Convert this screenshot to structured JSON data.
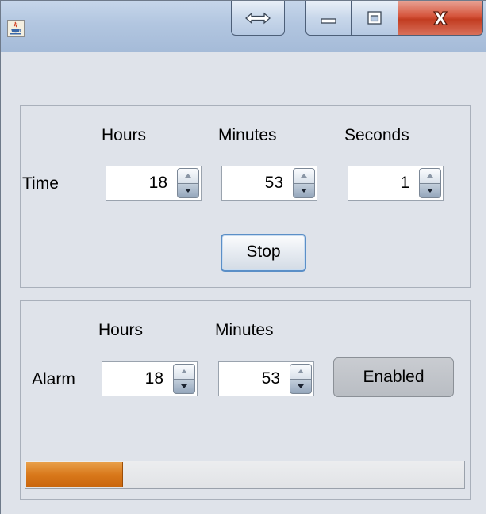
{
  "time_panel": {
    "row_label": "Time",
    "hours_label": "Hours",
    "minutes_label": "Minutes",
    "seconds_label": "Seconds",
    "hours_value": "18",
    "minutes_value": "53",
    "seconds_value": "1",
    "stop_label": "Stop"
  },
  "alarm_panel": {
    "row_label": "Alarm",
    "hours_label": "Hours",
    "minutes_label": "Minutes",
    "hours_value": "18",
    "minutes_value": "53",
    "enabled_label": "Enabled"
  },
  "progress": {
    "fraction": 0.22,
    "fill_color": "#d9781a"
  },
  "icons": {
    "app": "java-cup-icon",
    "resize": "horizontal-resize-icon",
    "minimize": "minimize-icon",
    "maximize": "maximize-icon",
    "close": "close-icon",
    "spin_up": "spin-up-arrow-icon",
    "spin_down": "spin-down-arrow-icon"
  },
  "colors": {
    "close_button": "#c23c21",
    "focus_border": "#5b8fc7"
  }
}
